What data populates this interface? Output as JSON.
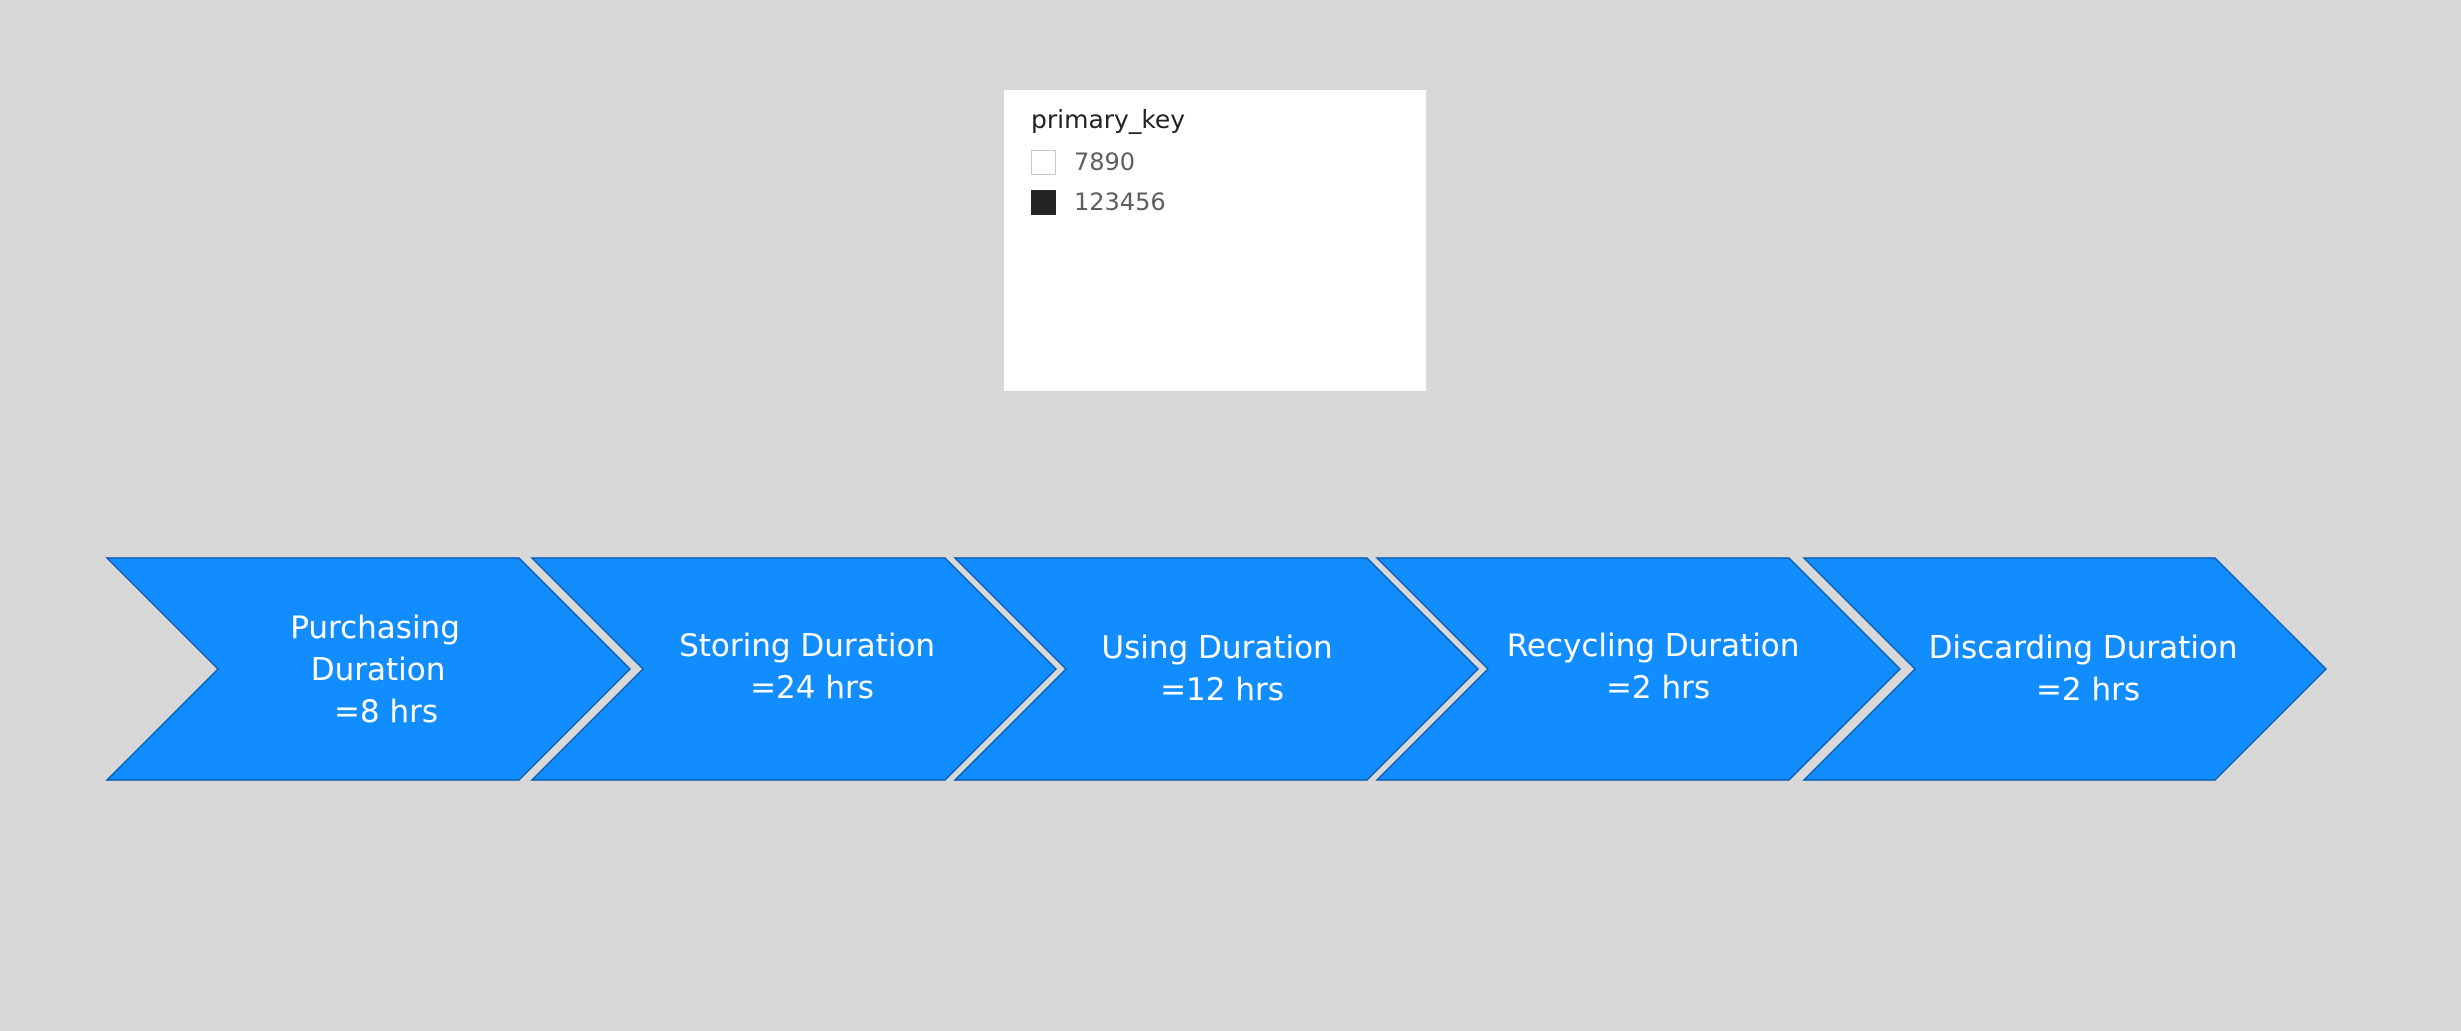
{
  "slicer": {
    "title": "primary_key",
    "items": [
      {
        "label": "7890",
        "checked": false
      },
      {
        "label": "123456",
        "checked": true
      }
    ]
  },
  "process": {
    "fill_color": "#118dff",
    "stroke_color": "#0b5fb0",
    "steps": [
      {
        "lines": [
          "Purchasing",
          "Duration",
          "=8 hrs"
        ]
      },
      {
        "lines": [
          "Storing Duration",
          "=24 hrs"
        ]
      },
      {
        "lines": [
          "Using Duration",
          "=12 hrs"
        ]
      },
      {
        "lines": [
          "Recycling Duration",
          "=2 hrs"
        ]
      },
      {
        "lines": [
          "Discarding Duration",
          "=2 hrs"
        ]
      }
    ]
  }
}
